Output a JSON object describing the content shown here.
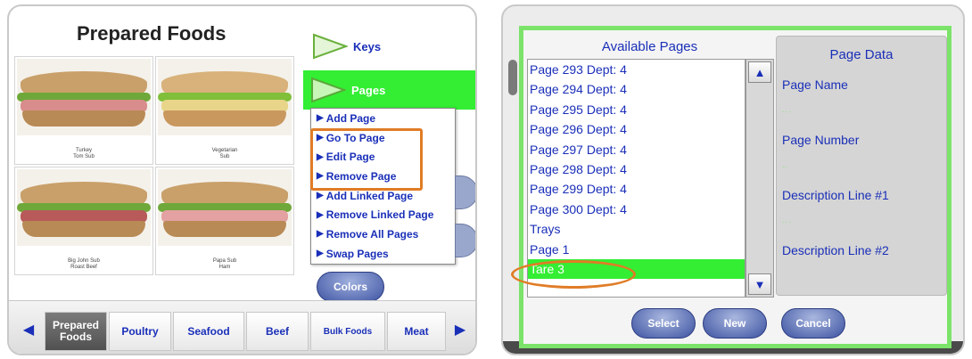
{
  "left": {
    "title": "Prepared Foods",
    "tiles": [
      {
        "caption": "Turkey\nTom Sub"
      },
      {
        "caption": "Vegetarian\nSub"
      },
      {
        "caption": "Big John Sub\nRoast Beef"
      },
      {
        "caption": "Papa Sub\nHam"
      }
    ],
    "keys_label": "Keys",
    "pages_label": "Pages",
    "pages_menu": [
      "Add Page",
      "Go To Page",
      "Edit Page",
      "Remove Page",
      "Add Linked Page",
      "Remove Linked Page",
      "Remove All Pages",
      "Swap Pages"
    ],
    "colors_label": "Colors",
    "category_tabs": [
      "Prepared Foods",
      "Poultry",
      "Seafood",
      "Beef",
      "Bulk Foods",
      "Meat"
    ],
    "active_tab": "Prepared Foods"
  },
  "right": {
    "available_title": "Available Pages",
    "list_items": [
      "Page 293 Dept: 4",
      "Page 294 Dept: 4",
      "Page 295 Dept: 4",
      "Page 296 Dept: 4",
      "Page 297 Dept: 4",
      "Page 298 Dept: 4",
      "Page 299 Dept: 4",
      "Page 300 Dept: 4",
      "Trays",
      "Page 1",
      "Tare 3"
    ],
    "selected_item": "Tare 3",
    "page_data_title": "Page Data",
    "page_name_label": "Page Name",
    "page_number_label": "Page Number",
    "desc1_label": "Description Line #1",
    "desc2_label": "Description Line #2",
    "select_label": "Select",
    "new_label": "New",
    "cancel_label": "Cancel"
  },
  "colors": {
    "accent_green": "#33ee33",
    "highlight_orange": "#e07c26",
    "link_blue": "#1a2fb8",
    "dialog_border": "#7ce36a"
  }
}
